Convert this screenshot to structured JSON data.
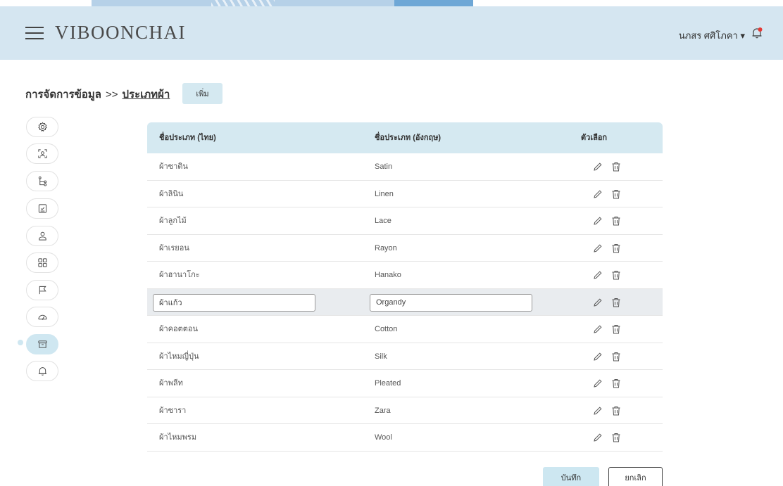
{
  "header": {
    "brand": "VIBOONCHAI",
    "user_label": "นภสร ศศิโภคา ▾"
  },
  "breadcrumb": {
    "root": "การจัดการข้อมูล",
    "separator": ">>",
    "current": "ประเภทผ้า",
    "add_label": "เพิ่ม"
  },
  "sidebar": {
    "items": [
      {
        "icon": "settings-icon"
      },
      {
        "icon": "face-scan-icon"
      },
      {
        "icon": "hierarchy-icon"
      },
      {
        "icon": "checklist-icon"
      },
      {
        "icon": "user-icon"
      },
      {
        "icon": "grid-icon"
      },
      {
        "icon": "flag-icon"
      },
      {
        "icon": "gauge-icon"
      },
      {
        "icon": "archive-icon",
        "active": true
      },
      {
        "icon": "bell-icon"
      }
    ]
  },
  "table": {
    "headers": [
      "ชื่อประเภท (ไทย)",
      "ชื่อประเภท (อังกฤษ)",
      "ตัวเลือก"
    ],
    "rows": [
      {
        "th": "ผ้าซาติน",
        "en": "Satin"
      },
      {
        "th": "ผ้าลินิน",
        "en": "Linen"
      },
      {
        "th": "ผ้าลูกไม้",
        "en": "Lace"
      },
      {
        "th": "ผ้าเรยอน",
        "en": "Rayon"
      },
      {
        "th": "ผ้าฮานาโกะ",
        "en": "Hanako"
      },
      {
        "th": "ผ้าแก้ว",
        "en": "Organdy",
        "editing": true
      },
      {
        "th": "ผ้าคอตตอน",
        "en": "Cotton"
      },
      {
        "th": "ผ้าไหมญี่ปุ่น",
        "en": "Silk"
      },
      {
        "th": "ผ้าพลีท",
        "en": "Pleated"
      },
      {
        "th": "ผ้าซารา",
        "en": "Zara"
      },
      {
        "th": "ผ้าไหมพรม",
        "en": "Wool"
      }
    ]
  },
  "footer": {
    "save_label": "บันทึก",
    "cancel_label": "ยกเลิก"
  },
  "colors": {
    "header_bg": "#d5e6f1",
    "accent": "#cde7f1",
    "notification_dot": "#e53935"
  }
}
